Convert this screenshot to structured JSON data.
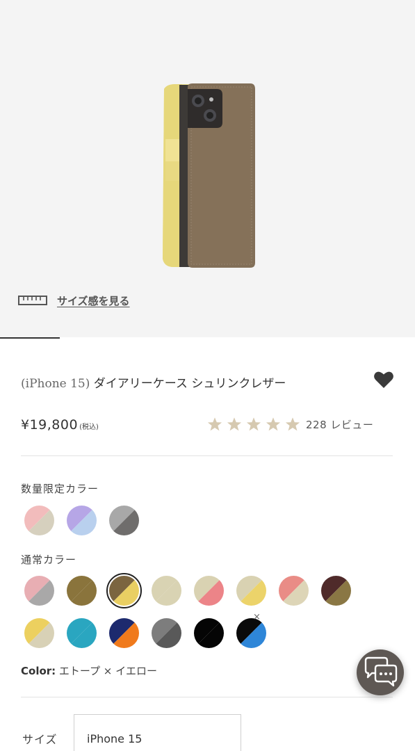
{
  "hero": {
    "size_link_label": "サイズ感を見る",
    "icon": "ruler-icon"
  },
  "product": {
    "title_prefix": "(iPhone 15)",
    "title_main": " ダイアリーケース シュリンクレザー",
    "favorite_icon": "heart-icon",
    "price": "¥19,800",
    "tax_label": "(税込)",
    "rating_stars": 5,
    "review_label": "228 レビュー",
    "star_color": "#d6c9b0"
  },
  "colors": {
    "limited_label": "数量限定カラー",
    "regular_label": "通常カラー",
    "limited": [
      {
        "c1": "#f2bcbc",
        "c2": "#d6d0be"
      },
      {
        "c1": "#b6a6e6",
        "c2": "#b9d0ee"
      },
      {
        "c1": "#a8a8a8",
        "c2": "#6f6d6c"
      }
    ],
    "regular": [
      {
        "c1": "#e8aeb3",
        "c2": "#a9a8a8"
      },
      {
        "c1": "#8a743c",
        "c2": "#8a743c"
      },
      {
        "c1": "#7b6540",
        "c2": "#e9cf63",
        "selected": true
      },
      {
        "c1": "#d9d3b3",
        "c2": "#d9d3b3"
      },
      {
        "c1": "#d9d2b2",
        "c2": "#ec8488"
      },
      {
        "c1": "#d9d2b2",
        "c2": "#ecd36a"
      },
      {
        "c1": "#e98c86",
        "c2": "#ddd5b7"
      },
      {
        "c1": "#4f2a2a",
        "c2": "#8a7744"
      },
      {
        "c1": "#ecd05f",
        "c2": "#d8d1b6"
      },
      {
        "c1": "#2aa6c0",
        "c2": "#2aa6c0"
      },
      {
        "c1": "#1d2a6e",
        "c2": "#f07a1c"
      },
      {
        "c1": "#7d7d7d",
        "c2": "#595959"
      },
      {
        "c1": "#050505",
        "c2": "#050505"
      },
      {
        "c1": "#0a0a0a",
        "c2": "#2e86d8",
        "sold_out": true
      }
    ],
    "current_label": "Color:",
    "current_value": " エトープ × イエロー"
  },
  "chat": {
    "icon": "chat-bubbles-icon"
  },
  "size": {
    "label": "サイズ",
    "value": "iPhone 15"
  }
}
